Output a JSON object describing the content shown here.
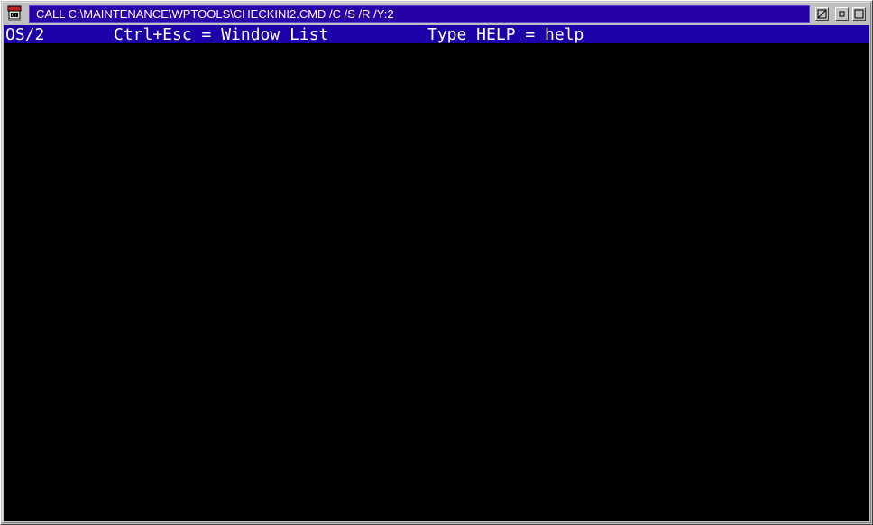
{
  "window": {
    "title": "CALL C:\\MAINTENANCE\\WPTOOLS\\CHECKINI2.CMD /C /S /R /Y:2",
    "icon": "os2-command-prompt-icon",
    "buttons": {
      "hide": "hide-icon",
      "restore": "restore-icon",
      "maximize": "maximize-icon"
    }
  },
  "console": {
    "status_line": {
      "os": "OS/2",
      "window_list": "Ctrl+Esc = Window List",
      "help": "Type HELP = help"
    },
    "colors": {
      "background": "#000000",
      "status_bar": "#1c00a8",
      "text": "#ffffff",
      "titlebar_active": "#2800a8"
    }
  }
}
